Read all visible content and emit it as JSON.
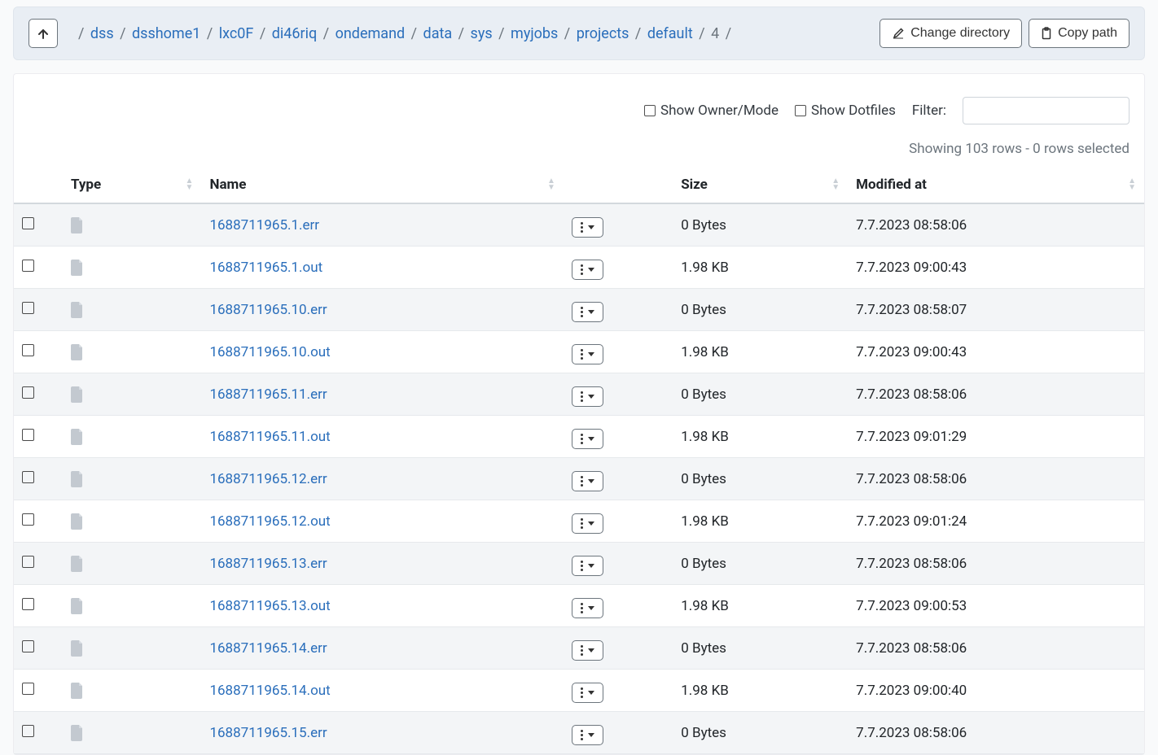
{
  "breadcrumb": {
    "items": [
      "dss",
      "dsshome1",
      "lxc0F",
      "di46riq",
      "ondemand",
      "data",
      "sys",
      "myjobs",
      "projects",
      "default"
    ],
    "current": "4"
  },
  "buttons": {
    "change_dir": "Change directory",
    "copy_path": "Copy path"
  },
  "toolbar": {
    "show_owner_mode": "Show Owner/Mode",
    "show_dotfiles": "Show Dotfiles",
    "filter_label": "Filter:",
    "filter_value": ""
  },
  "status": "Showing 103 rows - 0 rows selected",
  "columns": {
    "type": "Type",
    "name": "Name",
    "size": "Size",
    "modified": "Modified at"
  },
  "rows": [
    {
      "name": "1688711965.1.err",
      "size": "0 Bytes",
      "modified": "7.7.2023 08:58:06"
    },
    {
      "name": "1688711965.1.out",
      "size": "1.98 KB",
      "modified": "7.7.2023 09:00:43"
    },
    {
      "name": "1688711965.10.err",
      "size": "0 Bytes",
      "modified": "7.7.2023 08:58:07"
    },
    {
      "name": "1688711965.10.out",
      "size": "1.98 KB",
      "modified": "7.7.2023 09:00:43"
    },
    {
      "name": "1688711965.11.err",
      "size": "0 Bytes",
      "modified": "7.7.2023 08:58:06"
    },
    {
      "name": "1688711965.11.out",
      "size": "1.98 KB",
      "modified": "7.7.2023 09:01:29"
    },
    {
      "name": "1688711965.12.err",
      "size": "0 Bytes",
      "modified": "7.7.2023 08:58:06"
    },
    {
      "name": "1688711965.12.out",
      "size": "1.98 KB",
      "modified": "7.7.2023 09:01:24"
    },
    {
      "name": "1688711965.13.err",
      "size": "0 Bytes",
      "modified": "7.7.2023 08:58:06"
    },
    {
      "name": "1688711965.13.out",
      "size": "1.98 KB",
      "modified": "7.7.2023 09:00:53"
    },
    {
      "name": "1688711965.14.err",
      "size": "0 Bytes",
      "modified": "7.7.2023 08:58:06"
    },
    {
      "name": "1688711965.14.out",
      "size": "1.98 KB",
      "modified": "7.7.2023 09:00:40"
    },
    {
      "name": "1688711965.15.err",
      "size": "0 Bytes",
      "modified": "7.7.2023 08:58:06"
    }
  ]
}
